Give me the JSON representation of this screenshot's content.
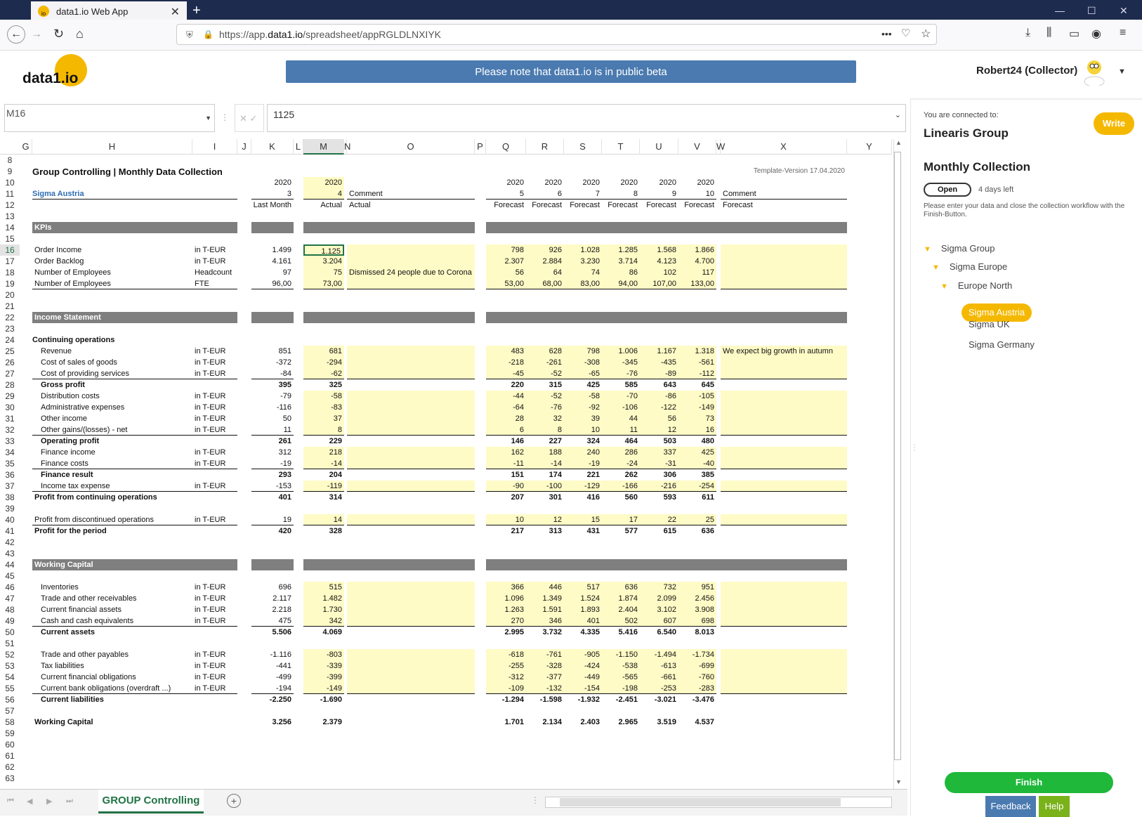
{
  "browser": {
    "tab_title": "data1.io Web App",
    "url_pre": "https://app.",
    "url_host": "data1.io",
    "url_post": "/spreadsheet/appRGLDLNXIYK"
  },
  "header": {
    "logo": "data1.io",
    "beta_notice": "Please note that data1.io is in public beta",
    "user": "Robert24 (Collector)"
  },
  "formula": {
    "name_box": "M16",
    "value": "1125"
  },
  "columns": [
    "G",
    "H",
    "I",
    "J",
    "K",
    "L",
    "M",
    "N",
    "O",
    "P",
    "Q",
    "R",
    "S",
    "T",
    "U",
    "V",
    "W",
    "X",
    "Y"
  ],
  "rows": [
    "8",
    "9",
    "10",
    "11",
    "12",
    "13",
    "14",
    "15",
    "16",
    "17",
    "18",
    "19",
    "20",
    "21",
    "22",
    "23",
    "24",
    "25",
    "26",
    "27",
    "28",
    "29",
    "30",
    "31",
    "32",
    "33",
    "34",
    "35",
    "36",
    "37",
    "38",
    "39",
    "40",
    "41",
    "42",
    "43",
    "44",
    "45",
    "46",
    "47",
    "48",
    "49",
    "50",
    "51",
    "52",
    "53",
    "54",
    "55",
    "56",
    "57",
    "58",
    "59",
    "60",
    "61",
    "62",
    "63"
  ],
  "sheet": {
    "title": "Group Controlling | Monthly Data Collection",
    "template_version": "Template-Version 17.04.2020",
    "entity": "Sigma Austria",
    "year": "2020",
    "last_month_no": "3",
    "actual_no": "4",
    "comment_label": "Comment",
    "last_month": "Last Month",
    "actual": "Actual",
    "forecast": "Forecast",
    "forecast_months": [
      "5",
      "6",
      "7",
      "8",
      "9",
      "10"
    ],
    "sections": {
      "kpis": "KPIs",
      "income": "Income Statement",
      "wc": "Working Capital",
      "cont_ops": "Continuing operations"
    },
    "lines": [
      {
        "row": 16,
        "label": "Order Income",
        "unit": "in T-EUR",
        "k": "1.499",
        "m": "1.125",
        "fc": [
          "798",
          "926",
          "1.028",
          "1.285",
          "1.568",
          "1.866"
        ],
        "y": true
      },
      {
        "row": 17,
        "label": "Order Backlog",
        "unit": "in T-EUR",
        "k": "4.161",
        "m": "3.204",
        "fc": [
          "2.307",
          "2.884",
          "3.230",
          "3.714",
          "4.123",
          "4.700"
        ],
        "y": true
      },
      {
        "row": 18,
        "label": "Number of Employees",
        "unit": "Headcount",
        "k": "97",
        "m": "75",
        "comment": "Dismissed 24 people due to Corona",
        "fc": [
          "56",
          "64",
          "74",
          "86",
          "102",
          "117"
        ],
        "y": true
      },
      {
        "row": 19,
        "label": "Number of Employees",
        "unit": "FTE",
        "k": "96,00",
        "m": "73,00",
        "fc": [
          "53,00",
          "68,00",
          "83,00",
          "94,00",
          "107,00",
          "133,00"
        ],
        "y": true,
        "ul": true
      },
      {
        "row": 25,
        "label": "Revenue",
        "unit": "in T-EUR",
        "k": "851",
        "m": "681",
        "fc": [
          "483",
          "628",
          "798",
          "1.006",
          "1.167",
          "1.318"
        ],
        "fcomment": "We expect big growth in autumn",
        "y": true,
        "ind": true
      },
      {
        "row": 26,
        "label": "Cost of sales of goods",
        "unit": "in T-EUR",
        "k": "-372",
        "m": "-294",
        "fc": [
          "-218",
          "-261",
          "-308",
          "-345",
          "-435",
          "-561"
        ],
        "y": true,
        "ind": true
      },
      {
        "row": 27,
        "label": "Cost of providing services",
        "unit": "in T-EUR",
        "k": "-84",
        "m": "-62",
        "fc": [
          "-45",
          "-52",
          "-65",
          "-76",
          "-89",
          "-112"
        ],
        "y": true,
        "ind": true,
        "ul": true
      },
      {
        "row": 28,
        "label": "Gross profit",
        "k": "395",
        "m": "325",
        "fc": [
          "220",
          "315",
          "425",
          "585",
          "643",
          "645"
        ],
        "b": true,
        "ind": true
      },
      {
        "row": 29,
        "label": "Distribution costs",
        "unit": "in T-EUR",
        "k": "-79",
        "m": "-58",
        "fc": [
          "-44",
          "-52",
          "-58",
          "-70",
          "-86",
          "-105"
        ],
        "y": true,
        "ind": true
      },
      {
        "row": 30,
        "label": "Administrative expenses",
        "unit": "in T-EUR",
        "k": "-116",
        "m": "-83",
        "fc": [
          "-64",
          "-76",
          "-92",
          "-106",
          "-122",
          "-149"
        ],
        "y": true,
        "ind": true
      },
      {
        "row": 31,
        "label": "Other income",
        "unit": "in T-EUR",
        "k": "50",
        "m": "37",
        "fc": [
          "28",
          "32",
          "39",
          "44",
          "56",
          "73"
        ],
        "y": true,
        "ind": true
      },
      {
        "row": 32,
        "label": "Other gains/(losses) - net",
        "unit": "in T-EUR",
        "k": "11",
        "m": "8",
        "fc": [
          "6",
          "8",
          "10",
          "11",
          "12",
          "16"
        ],
        "y": true,
        "ind": true,
        "ul": true
      },
      {
        "row": 33,
        "label": "Operating profit",
        "k": "261",
        "m": "229",
        "fc": [
          "146",
          "227",
          "324",
          "464",
          "503",
          "480"
        ],
        "b": true,
        "ind": true
      },
      {
        "row": 34,
        "label": "Finance income",
        "unit": "in T-EUR",
        "k": "312",
        "m": "218",
        "fc": [
          "162",
          "188",
          "240",
          "286",
          "337",
          "425"
        ],
        "y": true,
        "ind": true
      },
      {
        "row": 35,
        "label": "Finance costs",
        "unit": "in T-EUR",
        "k": "-19",
        "m": "-14",
        "fc": [
          "-11",
          "-14",
          "-19",
          "-24",
          "-31",
          "-40"
        ],
        "y": true,
        "ind": true,
        "ul": true
      },
      {
        "row": 36,
        "label": "Finance result",
        "k": "293",
        "m": "204",
        "fc": [
          "151",
          "174",
          "221",
          "262",
          "306",
          "385"
        ],
        "b": true,
        "ind": true
      },
      {
        "row": 37,
        "label": "Income tax expense",
        "unit": "in T-EUR",
        "k": "-153",
        "m": "-119",
        "fc": [
          "-90",
          "-100",
          "-129",
          "-166",
          "-216",
          "-254"
        ],
        "y": true,
        "ind": true,
        "ul": true
      },
      {
        "row": 38,
        "label": "Profit from continuing operations",
        "k": "401",
        "m": "314",
        "fc": [
          "207",
          "301",
          "416",
          "560",
          "593",
          "611"
        ],
        "b": true
      },
      {
        "row": 40,
        "label": "Profit from discontinued operations",
        "unit": "in T-EUR",
        "k": "19",
        "m": "14",
        "fc": [
          "10",
          "12",
          "15",
          "17",
          "22",
          "25"
        ],
        "y": true,
        "ul": true
      },
      {
        "row": 41,
        "label": "Profit for the period",
        "k": "420",
        "m": "328",
        "fc": [
          "217",
          "313",
          "431",
          "577",
          "615",
          "636"
        ],
        "b": true
      },
      {
        "row": 46,
        "label": "Inventories",
        "unit": "in T-EUR",
        "k": "696",
        "m": "515",
        "fc": [
          "366",
          "446",
          "517",
          "636",
          "732",
          "951"
        ],
        "y": true,
        "ind": true
      },
      {
        "row": 47,
        "label": "Trade and other receivables",
        "unit": "in T-EUR",
        "k": "2.117",
        "m": "1.482",
        "fc": [
          "1.096",
          "1.349",
          "1.524",
          "1.874",
          "2.099",
          "2.456"
        ],
        "y": true,
        "ind": true
      },
      {
        "row": 48,
        "label": "Current financial assets",
        "unit": "in T-EUR",
        "k": "2.218",
        "m": "1.730",
        "fc": [
          "1.263",
          "1.591",
          "1.893",
          "2.404",
          "3.102",
          "3.908"
        ],
        "y": true,
        "ind": true
      },
      {
        "row": 49,
        "label": "Cash and cash equivalents",
        "unit": "in T-EUR",
        "k": "475",
        "m": "342",
        "fc": [
          "270",
          "346",
          "401",
          "502",
          "607",
          "698"
        ],
        "y": true,
        "ind": true,
        "ul": true
      },
      {
        "row": 50,
        "label": "Current assets",
        "k": "5.506",
        "m": "4.069",
        "fc": [
          "2.995",
          "3.732",
          "4.335",
          "5.416",
          "6.540",
          "8.013"
        ],
        "b": true,
        "ind": true
      },
      {
        "row": 52,
        "label": "Trade and other payables",
        "unit": "in T-EUR",
        "k": "-1.116",
        "m": "-803",
        "fc": [
          "-618",
          "-761",
          "-905",
          "-1.150",
          "-1.494",
          "-1.734"
        ],
        "y": true,
        "ind": true
      },
      {
        "row": 53,
        "label": "Tax liabilities",
        "unit": "in T-EUR",
        "k": "-441",
        "m": "-339",
        "fc": [
          "-255",
          "-328",
          "-424",
          "-538",
          "-613",
          "-699"
        ],
        "y": true,
        "ind": true
      },
      {
        "row": 54,
        "label": "Current financial obligations",
        "unit": "in T-EUR",
        "k": "-499",
        "m": "-399",
        "fc": [
          "-312",
          "-377",
          "-449",
          "-565",
          "-661",
          "-760"
        ],
        "y": true,
        "ind": true
      },
      {
        "row": 55,
        "label": "Current bank obligations (overdraft ...)",
        "unit": "in T-EUR",
        "k": "-194",
        "m": "-149",
        "fc": [
          "-109",
          "-132",
          "-154",
          "-198",
          "-253",
          "-283"
        ],
        "y": true,
        "ind": true,
        "ul": true
      },
      {
        "row": 56,
        "label": "Current liabilities",
        "k": "-2.250",
        "m": "-1.690",
        "fc": [
          "-1.294",
          "-1.598",
          "-1.932",
          "-2.451",
          "-3.021",
          "-3.476"
        ],
        "b": true,
        "ind": true
      },
      {
        "row": 58,
        "label": "Working Capital",
        "k": "3.256",
        "m": "2.379",
        "fc": [
          "1.701",
          "2.134",
          "2.403",
          "2.965",
          "3.519",
          "4.537"
        ],
        "b": true
      }
    ]
  },
  "sheet_tab": "GROUP Controlling",
  "panel": {
    "connected_label": "You are connected to:",
    "org": "Linearis Group",
    "write": "Write",
    "collection": "Monthly Collection",
    "status": "Open",
    "days_left": "4 days left",
    "instruction": "Please enter your data and close the collection workflow with the Finish-Button.",
    "tree": [
      "Sigma Group",
      "Sigma Europe",
      "Europe North",
      "Sigma Austria",
      "Sigma UK",
      "Sigma Germany"
    ],
    "finish": "Finish",
    "feedback": "Feedback",
    "help": "Help"
  },
  "colors": {
    "accent": "#f5b800",
    "beta_bar": "#4a7ab0",
    "finish": "#1fb83a",
    "help": "#7ab21a",
    "input_yellow": "#fffbc6",
    "section_grey": "#7f7f7f"
  }
}
